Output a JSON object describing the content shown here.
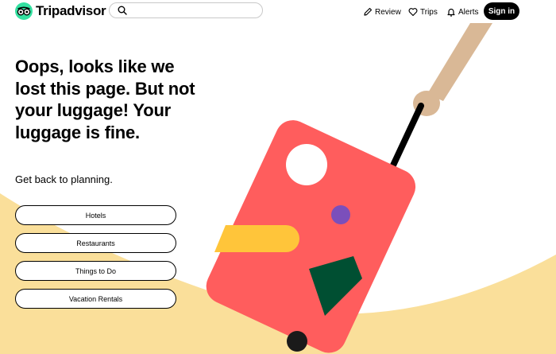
{
  "brand": {
    "name": "Tripadvisor",
    "color": "#34e0a1"
  },
  "search": {
    "placeholder": "",
    "value": "",
    "icon": "search-icon"
  },
  "nav": {
    "review_label": "Review",
    "trips_label": "Trips",
    "alerts_label": "Alerts",
    "signin_label": "Sign in"
  },
  "main": {
    "headline": "Oops, looks like we lost this page. But not your luggage! Your luggage is fine.",
    "subtext": "Get back to planning.",
    "buttons": [
      "Hotels",
      "Restaurants",
      "Things to Do",
      "Vacation Rentals"
    ]
  },
  "colors": {
    "suitcase": "#ff5d5d",
    "sand": "#fadf9a",
    "handle": "#d9b896",
    "stripe": "#ffc53a",
    "dot": "#7b4fbb",
    "patch": "#004f32"
  }
}
